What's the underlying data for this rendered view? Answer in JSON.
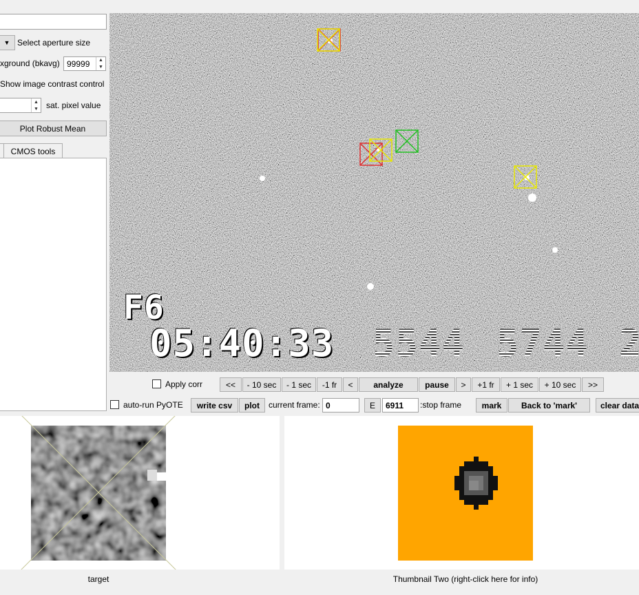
{
  "left_panel": {
    "top_field_value": "",
    "aperture_label": "Select aperture size",
    "background_label": "xground (bkavg)",
    "background_value": "99999",
    "contrast_label": "Show image contrast control",
    "sat_value": "",
    "sat_label": "sat. pixel value",
    "plot_robust_mean": "Plot Robust Mean",
    "tab_cmos": "CMOS tools"
  },
  "image_overlay": {
    "field_label": "F6",
    "timestamp": "05:40:33",
    "counter1": "5544",
    "counter2": "5744",
    "counter3": "2"
  },
  "apertures": [
    {
      "color": "#e03030"
    },
    {
      "color": "#e8e800"
    },
    {
      "color": "#e03030"
    },
    {
      "color": "#e8e800"
    },
    {
      "color": "#20c020"
    },
    {
      "color": "#e8e800"
    }
  ],
  "controls_row1": {
    "apply_corr": "Apply corr",
    "back_fast": "<<",
    "back_10sec": "- 10 sec",
    "back_1sec": "- 1 sec",
    "back_1fr": "-1 fr",
    "back_step": "<",
    "analyze": "analyze",
    "pause": "pause",
    "fwd_step": ">",
    "fwd_1fr": "+1 fr",
    "fwd_1sec": "+ 1 sec",
    "fwd_10sec": "+ 10 sec",
    "fwd_fast": ">>"
  },
  "controls_row2": {
    "auto_run": "auto-run PyOTE",
    "write_csv": "write csv",
    "plot": "plot",
    "current_frame_label": "current frame:",
    "current_frame_value": "0",
    "e_button": "E",
    "stop_frame_value": "6911",
    "stop_frame_label": ":stop frame",
    "mark": "mark",
    "back_to_mark": "Back to 'mark'",
    "clear_data": "clear data"
  },
  "thumbnails": {
    "one_label": "target",
    "two_label": "Thumbnail Two (right-click here for info)",
    "two_background": "#ffa500"
  }
}
